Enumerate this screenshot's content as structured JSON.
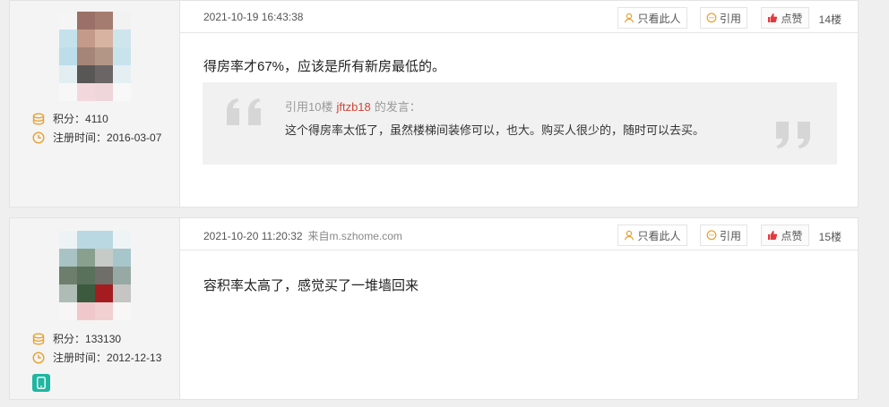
{
  "posts": [
    {
      "time": "2021-10-19 16:43:38",
      "source": "",
      "only_this_user": "只看此人",
      "quote_button": "引用",
      "like_button": "点赞",
      "floor": "14楼",
      "points_label": "积分：",
      "points": "4110",
      "reg_label": "注册时间：",
      "reg_date": "2016-03-07",
      "content": "得房率才67%，应该是所有新房最低的。",
      "quote": {
        "prefix": "引用10楼",
        "user": "jftzb18",
        "suffix": "的发言：",
        "text": "这个得房率太低了，虽然楼梯间装修可以，也大。购买人很少的，随时可以去买。"
      }
    },
    {
      "time": "2021-10-20 11:20:32",
      "source": "来自m.szhome.com",
      "only_this_user": "只看此人",
      "quote_button": "引用",
      "like_button": "点赞",
      "floor": "15楼",
      "points_label": "积分：",
      "points": "133130",
      "reg_label": "注册时间：",
      "reg_date": "2012-12-13",
      "content": "容积率太高了，感觉买了一堆墙回来"
    }
  ],
  "colors": {
    "accent_orange": "#e8a030",
    "like_red": "#e4393c",
    "quote_user": "#d04537",
    "mobile_teal": "#1fb6a2"
  }
}
